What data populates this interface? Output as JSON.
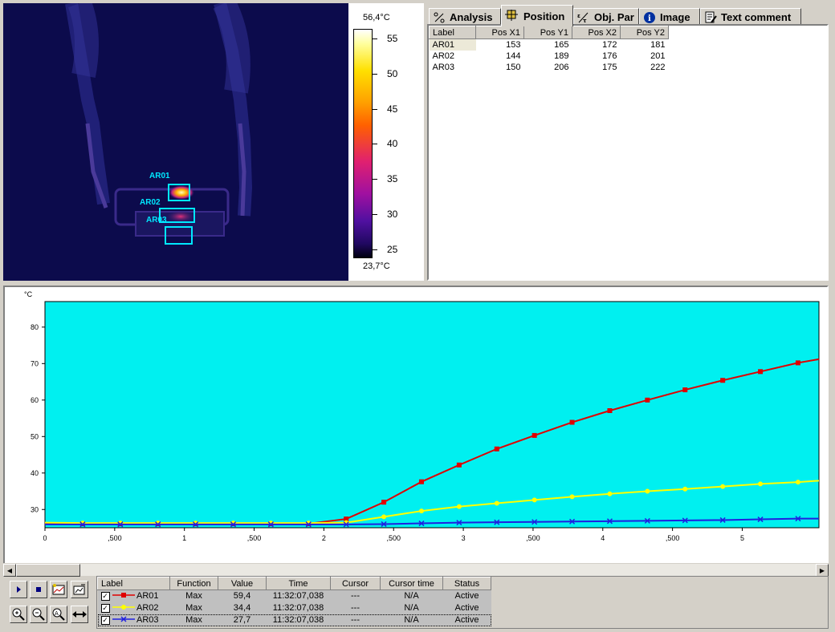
{
  "colors": {
    "ar01": "#e00000",
    "ar02": "#ffff00",
    "ar03": "#2020e0",
    "plot_bg": "#00f0f0",
    "roi_box": "#00e8ff"
  },
  "thermal": {
    "roi_labels": [
      "AR01",
      "AR02",
      "AR03"
    ]
  },
  "scale": {
    "max_label": "56,4°C",
    "min_label": "23,7°C",
    "ticks": [
      "55",
      "50",
      "45",
      "40",
      "35",
      "30",
      "25"
    ]
  },
  "tabs": [
    {
      "label": "Analysis",
      "icon": "analysis-icon"
    },
    {
      "label": "Position",
      "icon": "position-icon"
    },
    {
      "label": "Obj. Par",
      "icon": "object-parameters-icon"
    },
    {
      "label": "Image",
      "icon": "info-icon"
    },
    {
      "label": "Text comment",
      "icon": "text-comment-icon"
    }
  ],
  "position_table": {
    "headers": [
      "Label",
      "Pos X1",
      "Pos Y1",
      "Pos X2",
      "Pos Y2"
    ],
    "rows": [
      [
        "AR01",
        "153",
        "165",
        "172",
        "181"
      ],
      [
        "AR02",
        "144",
        "189",
        "176",
        "201"
      ],
      [
        "AR03",
        "150",
        "206",
        "175",
        "222"
      ]
    ]
  },
  "chart_data": {
    "type": "line",
    "ylabel": "°C",
    "xlabel": "",
    "xlim": [
      0,
      5.55
    ],
    "ylim": [
      25,
      87
    ],
    "x_ticks": [
      "0",
      ",500",
      "1",
      ",500",
      "2",
      ",500",
      "3",
      ",500",
      "4",
      ",500",
      "5"
    ],
    "x_tick_values": [
      0,
      0.5,
      1,
      1.5,
      2,
      2.5,
      3,
      3.5,
      4,
      4.5,
      5
    ],
    "y_ticks": [
      "30",
      "40",
      "50",
      "60",
      "70",
      "80"
    ],
    "y_tick_values": [
      30,
      40,
      50,
      60,
      70,
      80
    ],
    "grid": false,
    "series": [
      {
        "name": "AR01",
        "x": [
          0,
          0.27,
          0.54,
          0.81,
          1.08,
          1.35,
          1.62,
          1.89,
          2.16,
          2.43,
          2.7,
          2.97,
          3.24,
          3.51,
          3.78,
          4.05,
          4.32,
          4.59,
          4.86,
          5.13,
          5.4,
          5.55
        ],
        "y": [
          26.2,
          26.1,
          26.1,
          26.1,
          26.1,
          26.1,
          26.1,
          26.1,
          27.4,
          32,
          37.6,
          42.2,
          46.6,
          50.3,
          53.9,
          57.1,
          60,
          62.8,
          65.4,
          67.8,
          70.2,
          71.2
        ]
      },
      {
        "name": "AR02",
        "x": [
          0,
          0.27,
          0.54,
          0.81,
          1.08,
          1.35,
          1.62,
          1.89,
          2.16,
          2.43,
          2.7,
          2.97,
          3.24,
          3.51,
          3.78,
          4.05,
          4.32,
          4.59,
          4.86,
          5.13,
          5.4,
          5.55
        ],
        "y": [
          26.4,
          26.3,
          26.3,
          26.3,
          26.3,
          26.3,
          26.3,
          26.3,
          26.4,
          28,
          29.6,
          30.8,
          31.7,
          32.6,
          33.5,
          34.3,
          35,
          35.6,
          36.3,
          37,
          37.5,
          37.9
        ]
      },
      {
        "name": "AR03",
        "x": [
          0,
          0.27,
          0.54,
          0.81,
          1.08,
          1.35,
          1.62,
          1.89,
          2.16,
          2.43,
          2.7,
          2.97,
          3.24,
          3.51,
          3.78,
          4.05,
          4.32,
          4.59,
          4.86,
          5.13,
          5.4,
          5.55
        ],
        "y": [
          25.9,
          25.9,
          25.9,
          25.9,
          25.9,
          25.9,
          25.9,
          25.9,
          25.9,
          26,
          26.2,
          26.4,
          26.5,
          26.6,
          26.7,
          26.8,
          26.9,
          27,
          27.1,
          27.3,
          27.5,
          27.5
        ]
      }
    ]
  },
  "legend_table": {
    "headers": [
      "Label",
      "Function",
      "Value",
      "Time",
      "Cursor",
      "Cursor time",
      "Status"
    ],
    "rows": [
      {
        "label": "AR01",
        "function": "Max",
        "value": "59,4",
        "time": "11:32:07,038",
        "cursor": "---",
        "cursor_time": "N/A",
        "status": "Active"
      },
      {
        "label": "AR02",
        "function": "Max",
        "value": "34,4",
        "time": "11:32:07,038",
        "cursor": "---",
        "cursor_time": "N/A",
        "status": "Active"
      },
      {
        "label": "AR03",
        "function": "Max",
        "value": "27,7",
        "time": "11:32:07,038",
        "cursor": "---",
        "cursor_time": "N/A",
        "status": "Active"
      }
    ]
  }
}
